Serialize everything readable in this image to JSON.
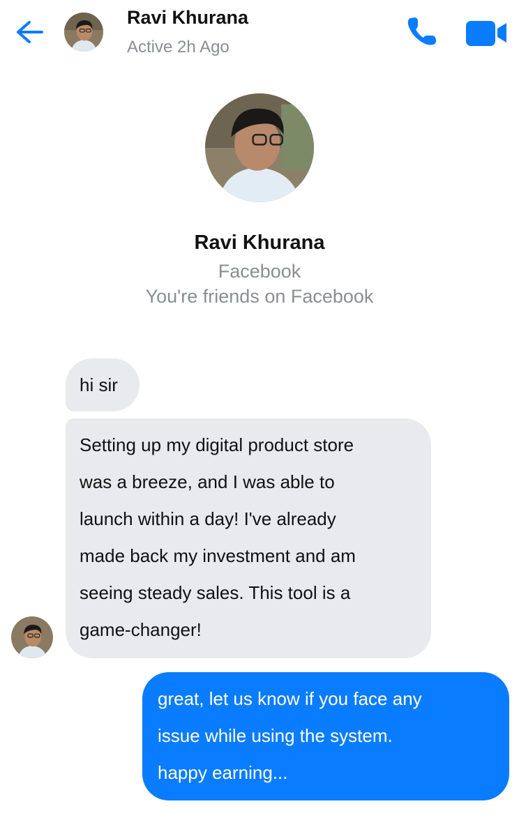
{
  "header": {
    "contact_name": "Ravi Khurana",
    "status": "Active 2h Ago",
    "accent_color": "#0a7cff",
    "icons": [
      "back-arrow-icon",
      "phone-icon",
      "video-camera-icon"
    ]
  },
  "profile": {
    "name": "Ravi Khurana",
    "source": "Facebook",
    "relationship": "You're friends on Facebook"
  },
  "messages": [
    {
      "direction": "incoming",
      "lines": [
        "hi sir"
      ]
    },
    {
      "direction": "incoming",
      "lines": [
        "Setting up my digital product store",
        "was a breeze, and I was able to",
        "launch within a day! I've already",
        "made back my investment and am",
        "seeing steady sales. This tool is a",
        "game-changer!"
      ]
    },
    {
      "direction": "outgoing",
      "lines": [
        "great, let us know if you face any",
        "issue while using the system.",
        "happy earning..."
      ]
    }
  ],
  "colors": {
    "incoming_bubble": "#e9eaed",
    "outgoing_bubble": "#0a7cff",
    "secondary_text": "#8a8d91"
  }
}
